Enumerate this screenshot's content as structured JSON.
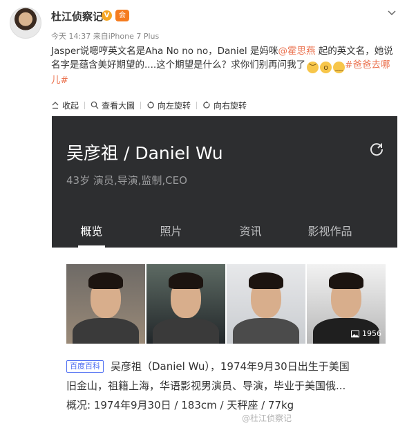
{
  "post": {
    "username": "杜江侦察记",
    "v_badge": "V",
    "member_badge": "会",
    "timestamp": "今天 14:37",
    "source": "来自iPhone 7 Plus",
    "text_part1": "Jasper说嗯哼英文名是Aha  No no no，Daniel 是妈咪",
    "mention": "@霍思燕",
    "text_part2": " 起的英文名，她说名字是蕴含美好期望的....这个期望是什么？求你们别再问我了",
    "hashtag": "#爸爸去哪儿#",
    "emojis": [
      "emoji-sad",
      "emoji-surprised",
      "emoji-sweat"
    ]
  },
  "toolbar": {
    "collect": "收起",
    "view_large": "查看大圖",
    "rotate_left": "向左旋转",
    "rotate_right": "向右旋转"
  },
  "card": {
    "name": "吴彦祖 / Daniel Wu",
    "subtitle": "43岁 演员,导演,监制,CEO",
    "tabs": [
      "概览",
      "照片",
      "资讯",
      "影视作品"
    ],
    "active_tab": "概览",
    "photo_count": "1956",
    "baike_badge": "百度百科",
    "desc_line1": "吴彦祖（Daniel Wu），1974年9月30日出生于美国",
    "desc_line2": "旧金山，祖籍上海，华语影视男演员、导演，毕业于美国俄...",
    "facts_label": "概况:",
    "facts_value": "1974年9月30日  /  183cm  /  天秤座  /  77kg",
    "watermark": "@杜江侦察记"
  },
  "colors": {
    "accent": "#eb7350",
    "card_dark": "#2d2e30",
    "baike_blue": "#4e6ef2"
  }
}
